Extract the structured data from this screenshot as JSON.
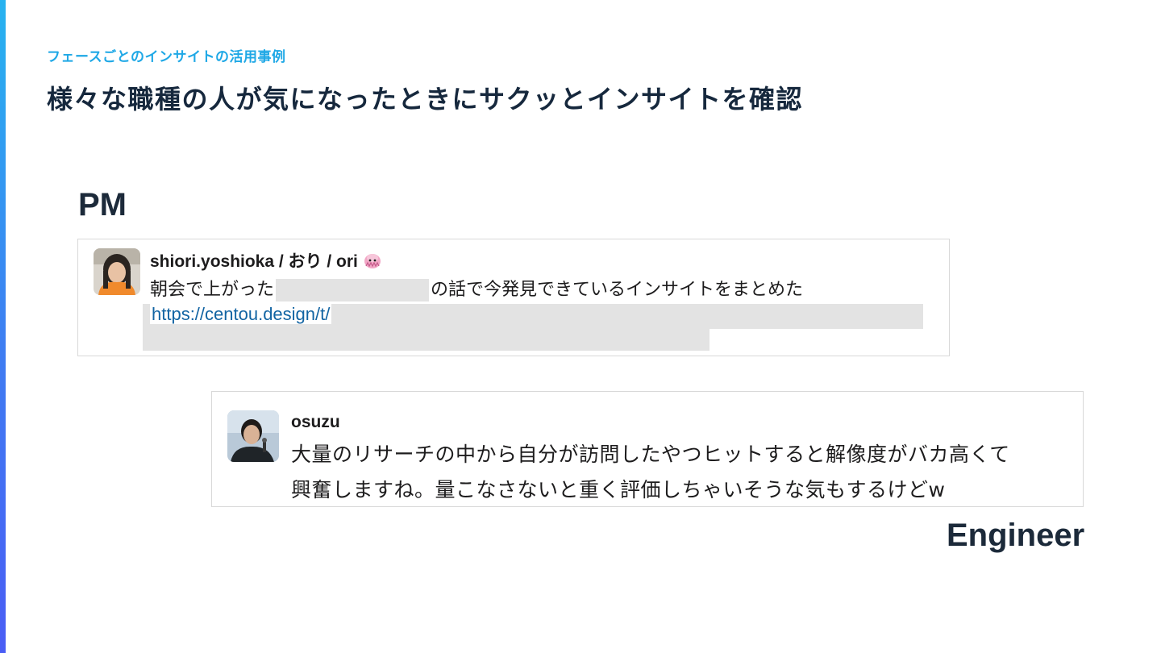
{
  "slide": {
    "eyebrow": "フェースごとのインサイトの活用事例",
    "title": "様々な職種の人が気になったときにサクッとインサイトを確認"
  },
  "roles": {
    "pm": "PM",
    "engineer": "Engineer"
  },
  "pm_message": {
    "author": "shiori.yoshioka / おり / ori",
    "text_before": "朝会で上がった",
    "text_after": "の話で今発見できているインサイトをまとめた",
    "link": "https://centou.design/t/"
  },
  "engineer_message": {
    "author": "osuzu",
    "line1": "大量のリサーチの中から自分が訪問したやつヒットすると解像度がバカ高くて",
    "line2": "興奮しますね。量こなさないと重く評価しちゃいそうな気もするけどw"
  },
  "colors": {
    "accent": "#1fa8e6",
    "title": "#16283d",
    "link": "#1264a3",
    "redaction": "#e3e3e3"
  }
}
